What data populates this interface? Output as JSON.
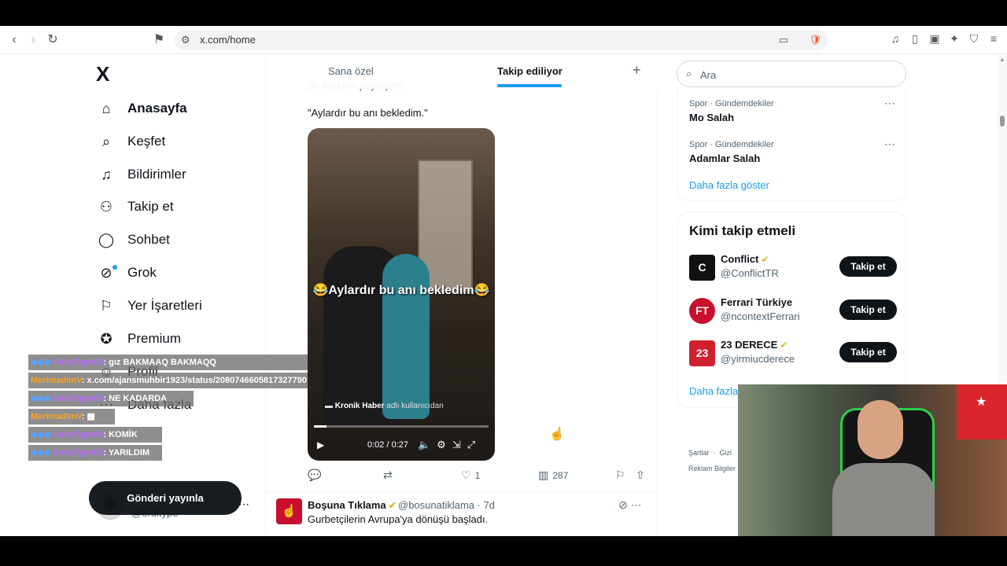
{
  "browser": {
    "url": "x.com/home",
    "badge": "1"
  },
  "sidebar": {
    "logo": "X",
    "items": [
      {
        "label": "Anasayfa",
        "icon": "home-icon",
        "glyph": "⌂"
      },
      {
        "label": "Keşfet",
        "icon": "search-icon",
        "glyph": "⌕"
      },
      {
        "label": "Bildirimler",
        "icon": "bell-icon",
        "glyph": "🔔"
      },
      {
        "label": "Takip et",
        "icon": "follow-icon",
        "glyph": "👤"
      },
      {
        "label": "Sohbet",
        "icon": "chat-icon",
        "glyph": "💬"
      },
      {
        "label": "Grok",
        "icon": "grok-icon",
        "glyph": "⊘"
      },
      {
        "label": "Yer İşaretleri",
        "icon": "bookmark-icon",
        "glyph": "🔖"
      },
      {
        "label": "Premium",
        "icon": "premium-icon",
        "glyph": "✪"
      },
      {
        "label": "Profil",
        "icon": "profile-icon",
        "glyph": "👤"
      },
      {
        "label": "Daha fazla",
        "icon": "more-icon",
        "glyph": "⋯"
      }
    ],
    "post_button": "Gönderi yayınla",
    "profile": {
      "name": "erdi",
      "handle": "@erditype"
    }
  },
  "timeline": {
    "tabs": [
      {
        "label": "Sana özel"
      },
      {
        "label": "Takip ediliyor"
      }
    ],
    "tweet": {
      "partial_text": "Bir kadının paylaşımı...",
      "text": "\"Aylardır bu anı bekledim.\"",
      "video": {
        "caption": "😂Aylardır bu anı bekledim😂",
        "watermark_bold": "Kronik Haber",
        "watermark_rest": " adlı kullanıcıdan",
        "time": "0:02 / 0:27",
        "progress": 0.074
      },
      "stats": {
        "likes": "1",
        "views": "287"
      }
    },
    "tweet2": {
      "name": "Boşuna Tıklama",
      "handle": "@bosunatiklama · 7d",
      "text": "Gurbetçilerin Avrupa'ya dönüşü başladı."
    }
  },
  "right": {
    "search_placeholder": "Ara",
    "trends": [
      {
        "meta": "Spor · Gündemdekiler",
        "name": "Mo Salah"
      },
      {
        "meta": "Spor · Gündemdekiler",
        "name": "Adamlar Salah"
      }
    ],
    "show_more": "Daha fazla göster",
    "who_to_follow": {
      "title": "Kimi takip etmeli",
      "accounts": [
        {
          "name": "Conflict",
          "handle": "@ConflictTR",
          "verified": true,
          "avatar_color": "#111111",
          "avatar_text": "C",
          "button": "Takip et"
        },
        {
          "name": "Ferrari Türkiye",
          "handle": "@ncontextFerrari",
          "verified": false,
          "avatar_color": "#c8102e",
          "avatar_text": "FT",
          "button": "Takip et"
        },
        {
          "name": "23 DERECE",
          "handle": "@yirmiucderece",
          "verified": true,
          "avatar_color": "#d0202e",
          "avatar_text": "23",
          "button": "Takip et"
        }
      ],
      "show_more": "Daha fazla"
    },
    "footer": [
      "Şartlar",
      "Gizl",
      "Reklam Bilgiler"
    ]
  },
  "chat": [
    {
      "user": "CekoType06",
      "color": "purple",
      "message": ": gız BAKMAAQ BAKMAQQ"
    },
    {
      "user": "MerimadimV",
      "color": "orange",
      "message": ": x.com/ajansmuhbir1923/status/2080746605817327790?s=20"
    },
    {
      "user": "CekoType06",
      "color": "purple",
      "message": ": NE KADARDA"
    },
    {
      "user": "MerimadimV",
      "color": "orange",
      "message": ":"
    },
    {
      "user": "CekoType06",
      "color": "purple",
      "message": ": KOMİK"
    },
    {
      "user": "CekoType06",
      "color": "purple",
      "message": ": YARILDIM"
    }
  ]
}
